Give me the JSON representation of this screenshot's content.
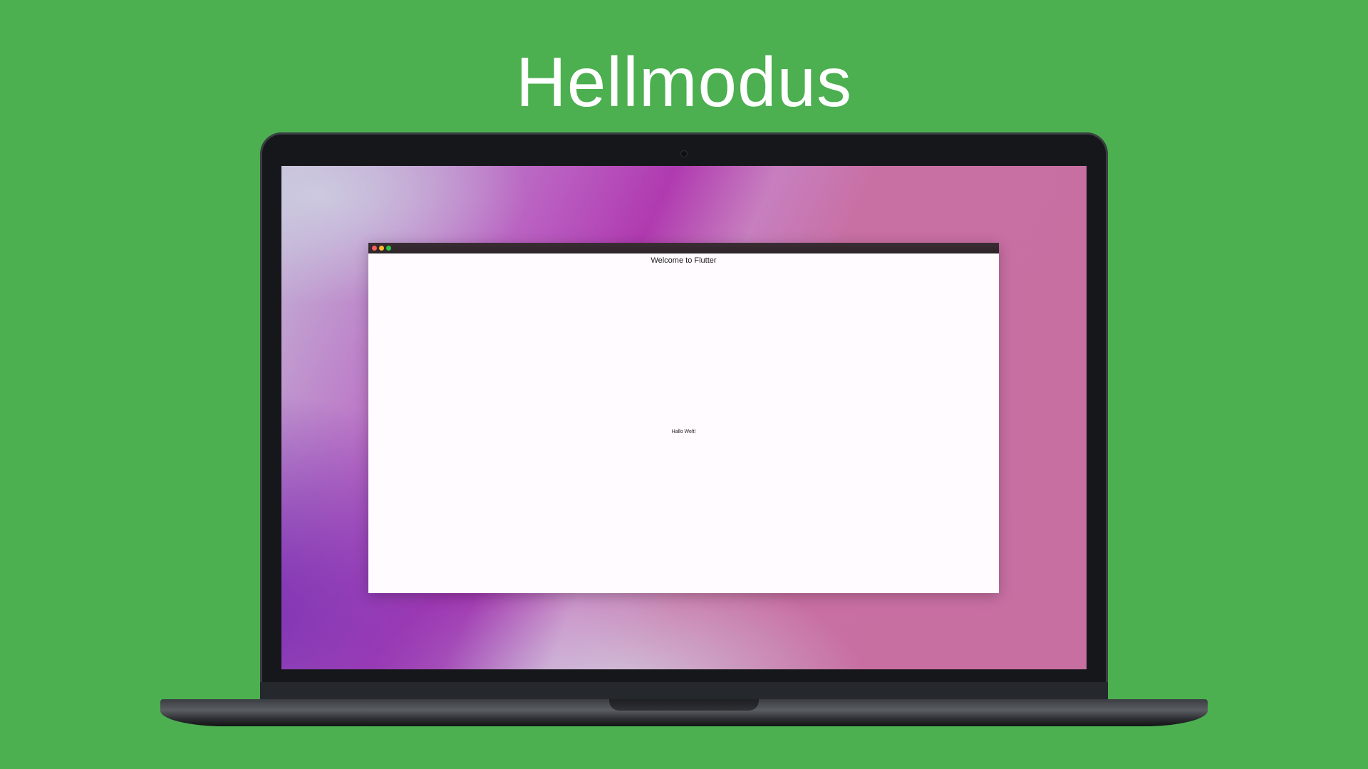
{
  "header": {
    "title": "Hellmodus"
  },
  "app": {
    "appbar_title": "Welcome to Flutter",
    "body_text": "Hallo Welt!",
    "window_controls": [
      "close-icon",
      "minimize-icon",
      "maximize-icon"
    ]
  },
  "colors": {
    "background": "#4caf50",
    "laptop_bezel": "#15171a",
    "app_surface": "#fffbfe",
    "titlebar": "#2d2429",
    "close": "#ff5f57",
    "minimize": "#febc2e",
    "maximize": "#28c840"
  }
}
